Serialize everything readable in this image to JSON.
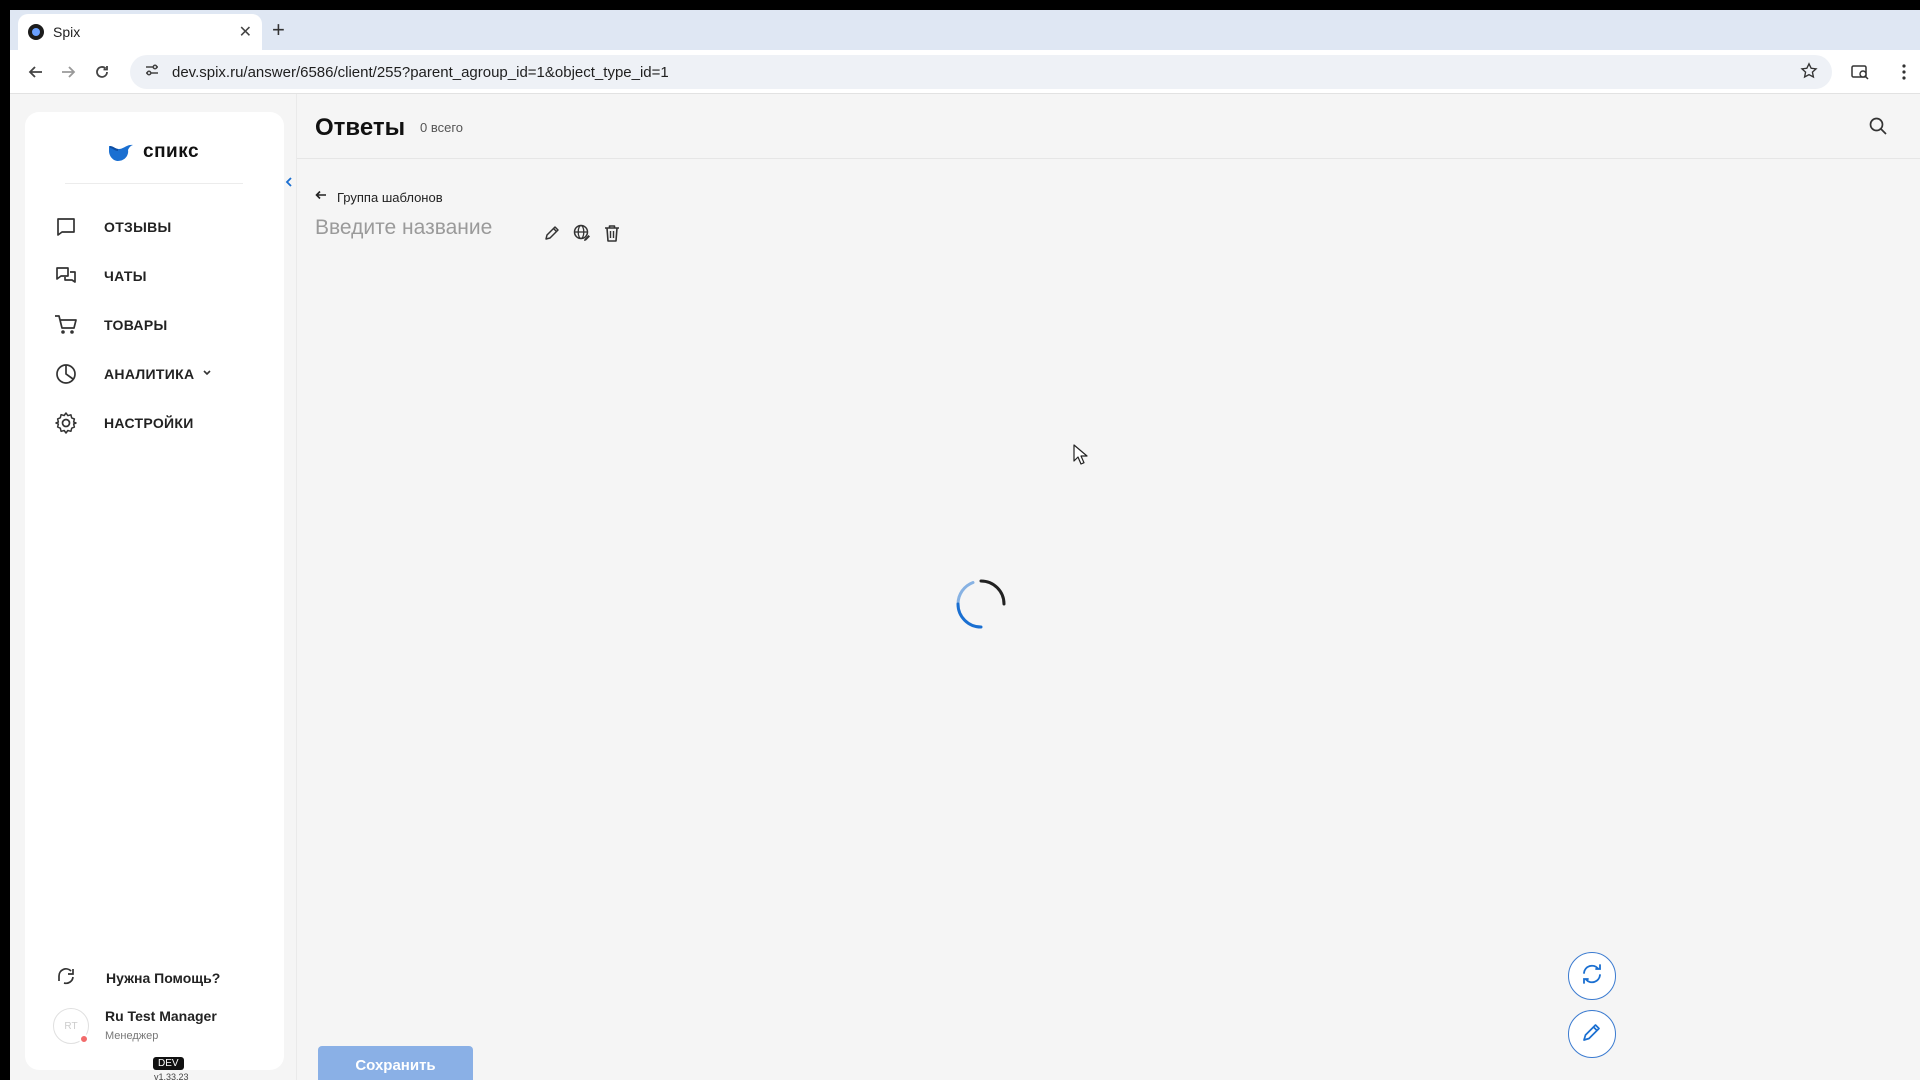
{
  "browser": {
    "tab_title": "Spix",
    "tab_close": "✕",
    "new_tab": "+",
    "url": "dev.spix.ru/answer/6586/client/255?parent_agroup_id=1&object_type_id=1"
  },
  "sidebar": {
    "logo_text": "спикс",
    "items": [
      {
        "label": "ОТЗЫВЫ",
        "icon": "message-square-icon"
      },
      {
        "label": "ЧАТЫ",
        "icon": "chats-icon"
      },
      {
        "label": "ТОВАРЫ",
        "icon": "cart-icon"
      },
      {
        "label": "АНАЛИТИКА",
        "icon": "pie-chart-icon"
      },
      {
        "label": "НАСТРОЙКИ",
        "icon": "gear-icon"
      }
    ],
    "help_label": "Нужна Помощь?",
    "user": {
      "initials": "RT",
      "name": "Ru Test Manager",
      "role": "Менеджер"
    },
    "env_badge": "DEV",
    "version": "v1.33.23"
  },
  "header": {
    "title": "Ответы",
    "count": "0 всего"
  },
  "content": {
    "back_label": "Группа шаблонов",
    "name_placeholder": "Введите название",
    "save_label": "Сохранить"
  },
  "colors": {
    "accent": "#1a6fd1",
    "save_disabled": "#8ab0e6"
  }
}
